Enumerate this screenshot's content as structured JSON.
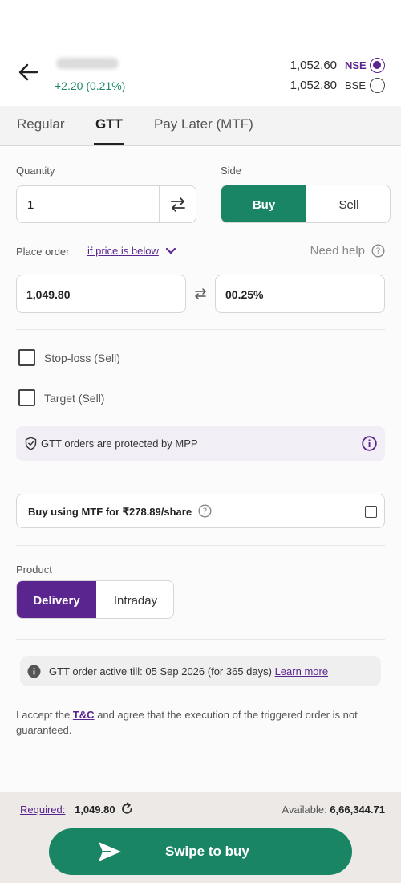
{
  "header": {
    "stock_change": "+2.20 (0.21%)",
    "exchanges": [
      {
        "price": "1,052.60",
        "name": "NSE",
        "selected": true
      },
      {
        "price": "1,052.80",
        "name": "BSE",
        "selected": false
      }
    ]
  },
  "tabs": [
    {
      "label": "Regular",
      "active": false
    },
    {
      "label": "GTT",
      "active": true
    },
    {
      "label": "Pay Later (MTF)",
      "active": false
    }
  ],
  "quantity": {
    "label": "Quantity",
    "value": "1"
  },
  "side": {
    "label": "Side",
    "buy_label": "Buy",
    "sell_label": "Sell",
    "selected": "Buy"
  },
  "place_order": {
    "label": "Place order",
    "condition": "if price is below",
    "help_label": "Need help",
    "price_value": "1,049.80",
    "percent_value": "00.25%"
  },
  "stop_loss": {
    "label": "Stop-loss (Sell)",
    "checked": false
  },
  "target": {
    "label": "Target (Sell)",
    "checked": false
  },
  "mpp_info": {
    "text": "GTT orders are protected by MPP"
  },
  "mtf": {
    "label": "Buy using MTF for ₹278.89/share",
    "checked": false
  },
  "product": {
    "label": "Product",
    "delivery_label": "Delivery",
    "intraday_label": "Intraday",
    "selected": "Delivery"
  },
  "gtt_note": {
    "text": "GTT order active till: 05 Sep 2026 (for 365 days)",
    "link": "Learn more"
  },
  "terms": {
    "prefix": "I accept the",
    "link": "T&C",
    "suffix": "and agree that the execution of the triggered order is not guaranteed."
  },
  "footer": {
    "required_label": "Required:",
    "required_value": "1,049.80",
    "available_label": "Available:",
    "available_value": "6,66,344.71",
    "swipe_label": "Swipe to buy"
  },
  "colors": {
    "brand_purple": "#5b2590",
    "buy_green": "#198565",
    "positive_green": "#1b8a63"
  }
}
